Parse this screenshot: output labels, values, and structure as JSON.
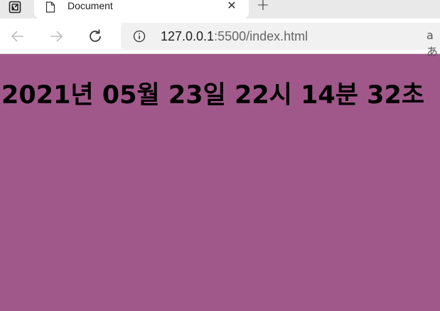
{
  "tab": {
    "title": "Document",
    "close_glyph": "✕",
    "new_tab_glyph": "+"
  },
  "address_bar": {
    "url_host": "127.0.0.1",
    "url_rest": ":5500/index.html",
    "read_aloud_glyph": "aあ"
  },
  "page": {
    "background": "#a0588a",
    "clock_text": "2021년 05월 23일 22시 14분 32초"
  }
}
